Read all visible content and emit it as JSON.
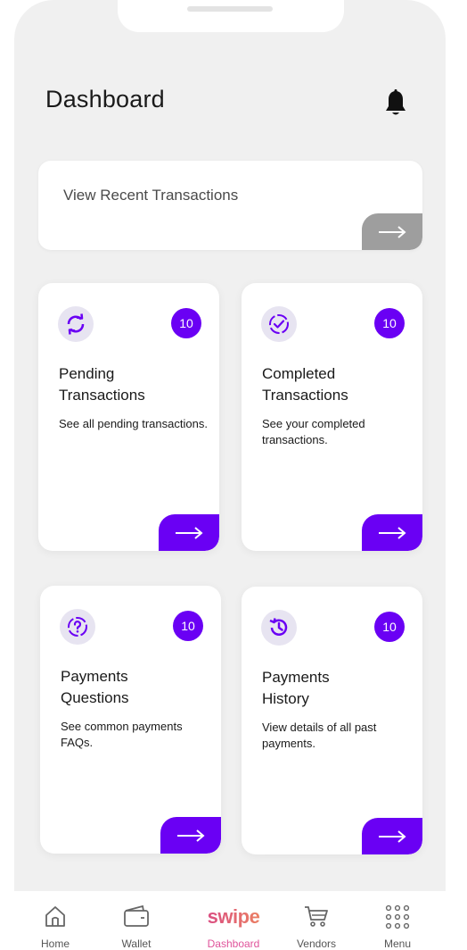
{
  "header": {
    "title": "Dashboard",
    "notification_icon": "bell-icon"
  },
  "recent": {
    "label": "View Recent Transactions",
    "arrow_icon": "arrow-right-icon",
    "accent": "#9e9e9e"
  },
  "cards": [
    {
      "icon": "refresh-icon",
      "badge": "10",
      "title_line1": "Pending",
      "title_line2": "Transactions",
      "description": "See all pending transactions."
    },
    {
      "icon": "check-circle-icon",
      "badge": "10",
      "title_line1": "Completed",
      "title_line2": "Transactions",
      "description": "See your completed transactions."
    },
    {
      "icon": "question-circle-icon",
      "badge": "10",
      "title_line1": "Payments",
      "title_line2": "Questions",
      "description": "See common payments FAQs."
    },
    {
      "icon": "history-icon",
      "badge": "10",
      "title_line1": "Payments",
      "title_line2": "History",
      "description": "View details of all past payments."
    }
  ],
  "nav": {
    "items": [
      {
        "label": "Home",
        "icon": "home-icon"
      },
      {
        "label": "Wallet",
        "icon": "wallet-icon"
      },
      {
        "label": "Dashboard",
        "icon": "swipe-logo",
        "logo_text": "swipe",
        "active": true
      },
      {
        "label": "Vendors",
        "icon": "cart-icon"
      },
      {
        "label": "Menu",
        "icon": "grid-menu-icon"
      }
    ]
  },
  "colors": {
    "accent": "#6a00f4",
    "background": "#f0f0f0",
    "card": "#ffffff",
    "active_nav": "#e0539b"
  }
}
